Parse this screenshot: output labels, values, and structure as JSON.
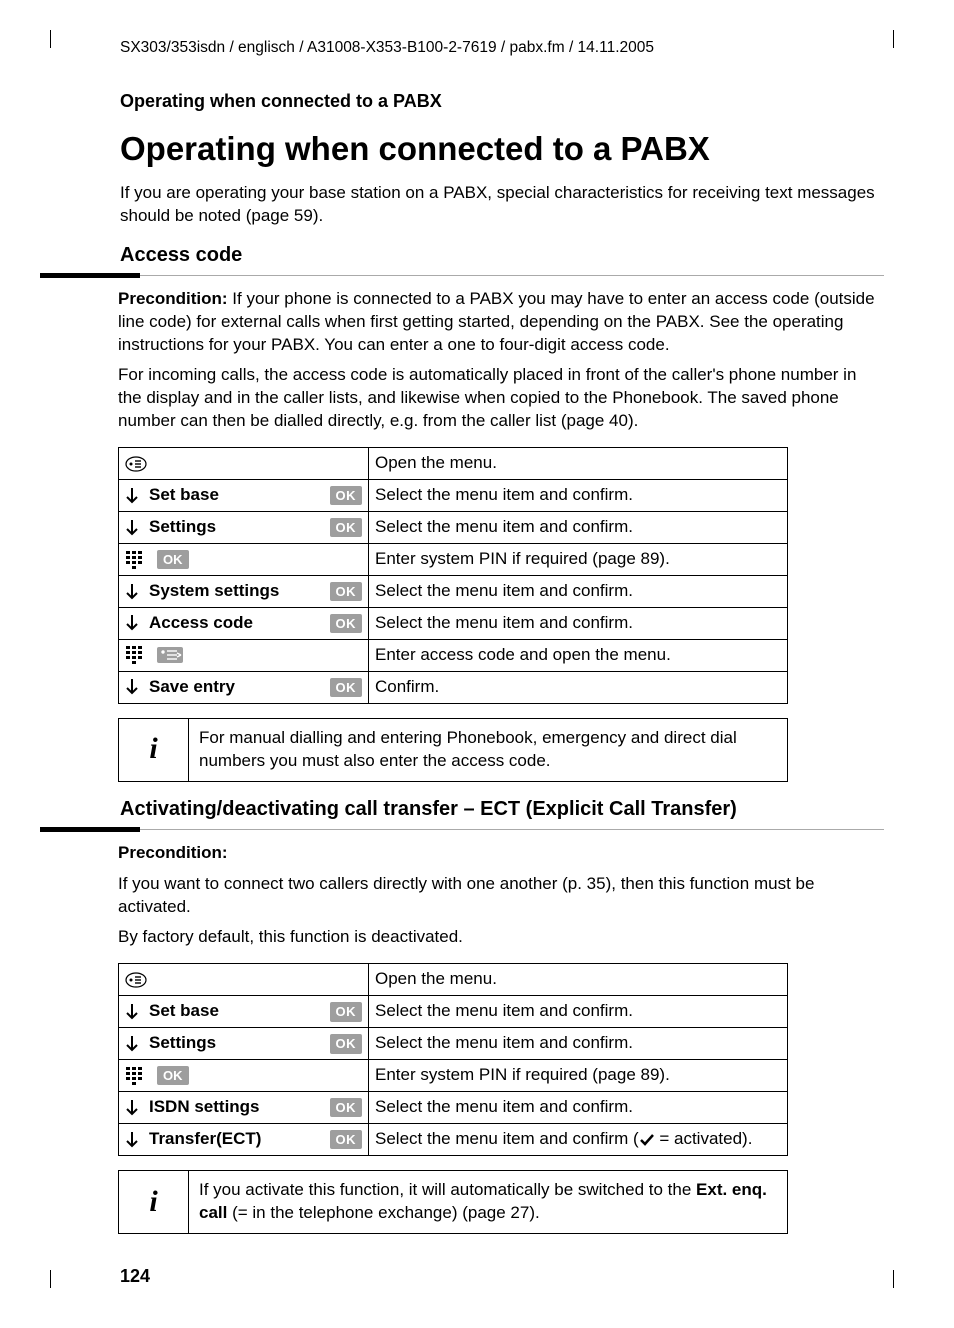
{
  "header_path": "SX303/353isdn / englisch / A31008-X353-B100-2-7619 / pabx.fm / 14.11.2005",
  "running_head": "Operating when connected to a PABX",
  "title": "Operating when connected to a PABX",
  "intro": "If you are operating your base station on a PABX, special characteristics for receiving text messages should be noted (page 59).",
  "section1": {
    "heading": "Access code",
    "precond_label": "Precondition:",
    "precond_text": " If your phone is connected to a PABX you may have to enter an access code (outside line code) for external calls when first getting started, depending on the PABX. See the operating instructions for your PABX. You can enter a one to four-digit access code.",
    "para2": "For incoming calls, the access code is automatically placed in front of the caller's phone number in the display and in the caller lists, and likewise when copied to the Phonebook. The saved phone number can then be dialled directly, e.g. from the caller list (page 40).",
    "rows": [
      {
        "icons": [
          "menu"
        ],
        "label": "",
        "ok": false,
        "desc": "Open the menu."
      },
      {
        "icons": [
          "down"
        ],
        "label": "Set base",
        "ok": true,
        "desc": "Select the menu item and confirm."
      },
      {
        "icons": [
          "down"
        ],
        "label": "Settings",
        "ok": true,
        "desc": "Select the menu item and confirm."
      },
      {
        "icons": [
          "keypad",
          "ok-inline"
        ],
        "label": "",
        "ok": false,
        "desc": "Enter system PIN if required (page 89)."
      },
      {
        "icons": [
          "down"
        ],
        "label": "System settings",
        "ok": true,
        "desc": "Select the menu item and confirm."
      },
      {
        "icons": [
          "down"
        ],
        "label": "Access code",
        "ok": true,
        "desc": "Select the menu item and confirm."
      },
      {
        "icons": [
          "keypad",
          "submenu"
        ],
        "label": "",
        "ok": false,
        "desc": "Enter access code and open the menu."
      },
      {
        "icons": [
          "down"
        ],
        "label": "Save entry",
        "ok": true,
        "desc": "Confirm."
      }
    ],
    "note": "For manual dialling and entering Phonebook, emergency and direct dial numbers you must also enter the access code."
  },
  "section2": {
    "heading": "Activating/deactivating call transfer – ECT (Explicit Call Transfer)",
    "precond_label": "Precondition:",
    "para1": "If you want to connect two callers directly with one another (p. 35), then this function must be activated.",
    "para2": "By factory default, this function is deactivated.",
    "rows": [
      {
        "icons": [
          "menu"
        ],
        "label": "",
        "ok": false,
        "desc": "Open the menu."
      },
      {
        "icons": [
          "down"
        ],
        "label": "Set base",
        "ok": true,
        "desc": "Select the menu item and confirm."
      },
      {
        "icons": [
          "down"
        ],
        "label": "Settings",
        "ok": true,
        "desc": "Select the menu item and confirm."
      },
      {
        "icons": [
          "keypad",
          "ok-inline"
        ],
        "label": "",
        "ok": false,
        "desc": "Enter system PIN if required (page 89)."
      },
      {
        "icons": [
          "down"
        ],
        "label": "ISDN settings",
        "ok": true,
        "desc": "Select the menu item and confirm."
      },
      {
        "icons": [
          "down"
        ],
        "label": "Transfer(ECT)",
        "ok": true,
        "desc_parts": [
          "Select the menu item and confirm (",
          "check",
          " = activated)."
        ]
      }
    ],
    "note_parts": [
      "If you activate this function, it will automatically be switched to the ",
      "Ext. enq. call",
      " (= in the telephone exchange) (page 27)."
    ]
  },
  "page_number": "124",
  "ok_label": "OK"
}
